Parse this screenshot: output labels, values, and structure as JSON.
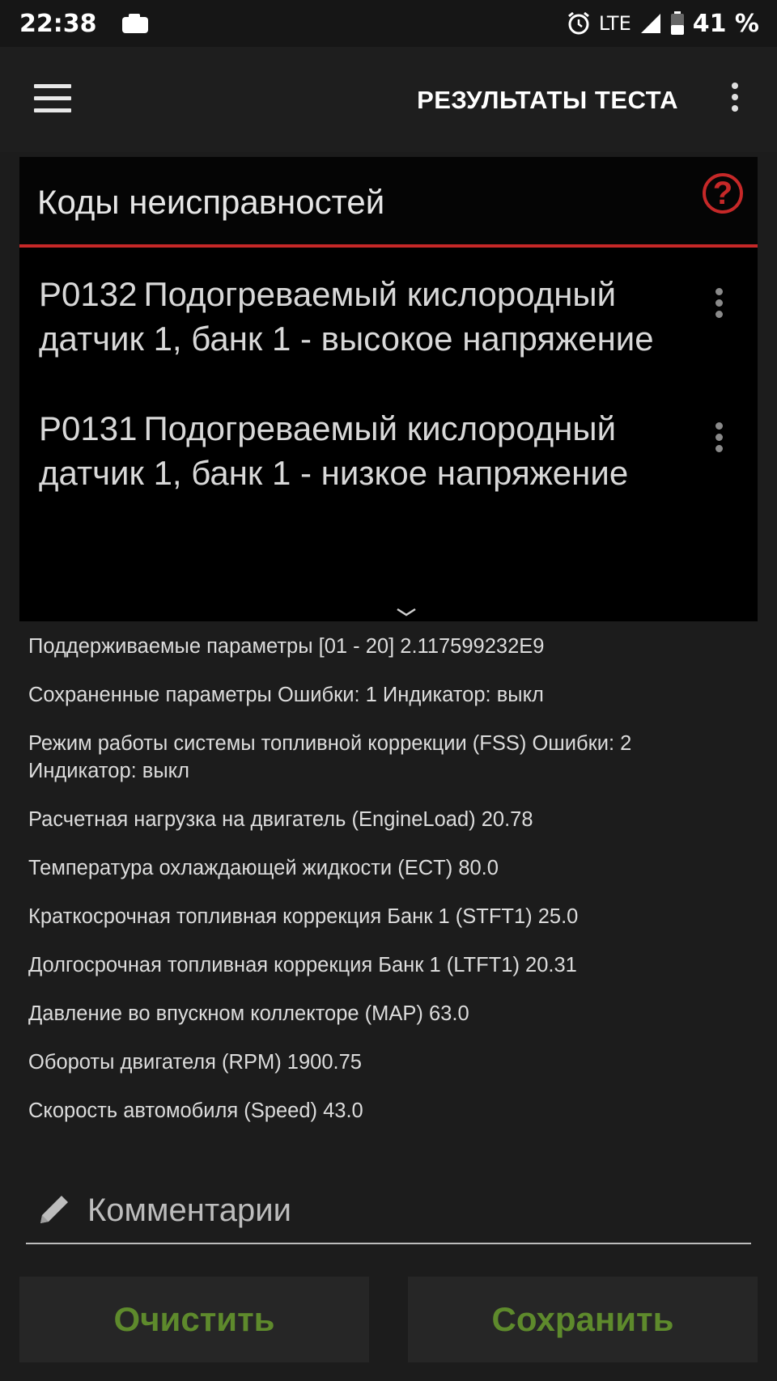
{
  "status_bar": {
    "time": "22:38",
    "network": "LTE",
    "battery": "41 %"
  },
  "app_bar": {
    "title": "РЕЗУЛЬТАТЫ ТЕСТА"
  },
  "dtc_card": {
    "title": "Коды неисправностей",
    "help_symbol": "?",
    "items": [
      {
        "code": "P0132",
        "description": "Подогреваемый кислородный датчик 1, банк 1 - высокое напряжение"
      },
      {
        "code": "P0131",
        "description": "Подогреваемый кислородный датчик 1, банк 1 - низкое напряжение"
      }
    ]
  },
  "parameters": [
    "Поддерживаемые параметры [01 - 20] 2.117599232E9",
    "Сохраненные параметры Ошибки: 1 Индикатор: выкл",
    "Режим работы системы топливной коррекции (FSS) Ошибки: 2 Индикатор: выкл",
    "Расчетная нагрузка на двигатель (EngineLoad) 20.78",
    "Температура охлаждающей жидкости (ECT) 80.0",
    "Краткосрочная топливная коррекция Банк 1 (STFT1) 25.0",
    "Долгосрочная топливная коррекция Банк 1 (LTFT1) 20.31",
    "Давление во впускном коллекторе (MAP) 63.0",
    "Обороты двигателя (RPM) 1900.75",
    "Скорость автомобиля (Speed) 43.0"
  ],
  "comment": {
    "placeholder": "Комментарии",
    "value": ""
  },
  "buttons": {
    "clear_label": "Очистить",
    "save_label": "Сохранить"
  },
  "colors": {
    "accent_red": "#c62828",
    "button_text_green": "#5e8a2c"
  },
  "icons": [
    "camera-icon",
    "alarm-icon",
    "signal-icon",
    "battery-icon",
    "menu-icon",
    "overflow-menu-icon",
    "help-icon",
    "chevron-down-icon",
    "pencil-icon"
  ]
}
